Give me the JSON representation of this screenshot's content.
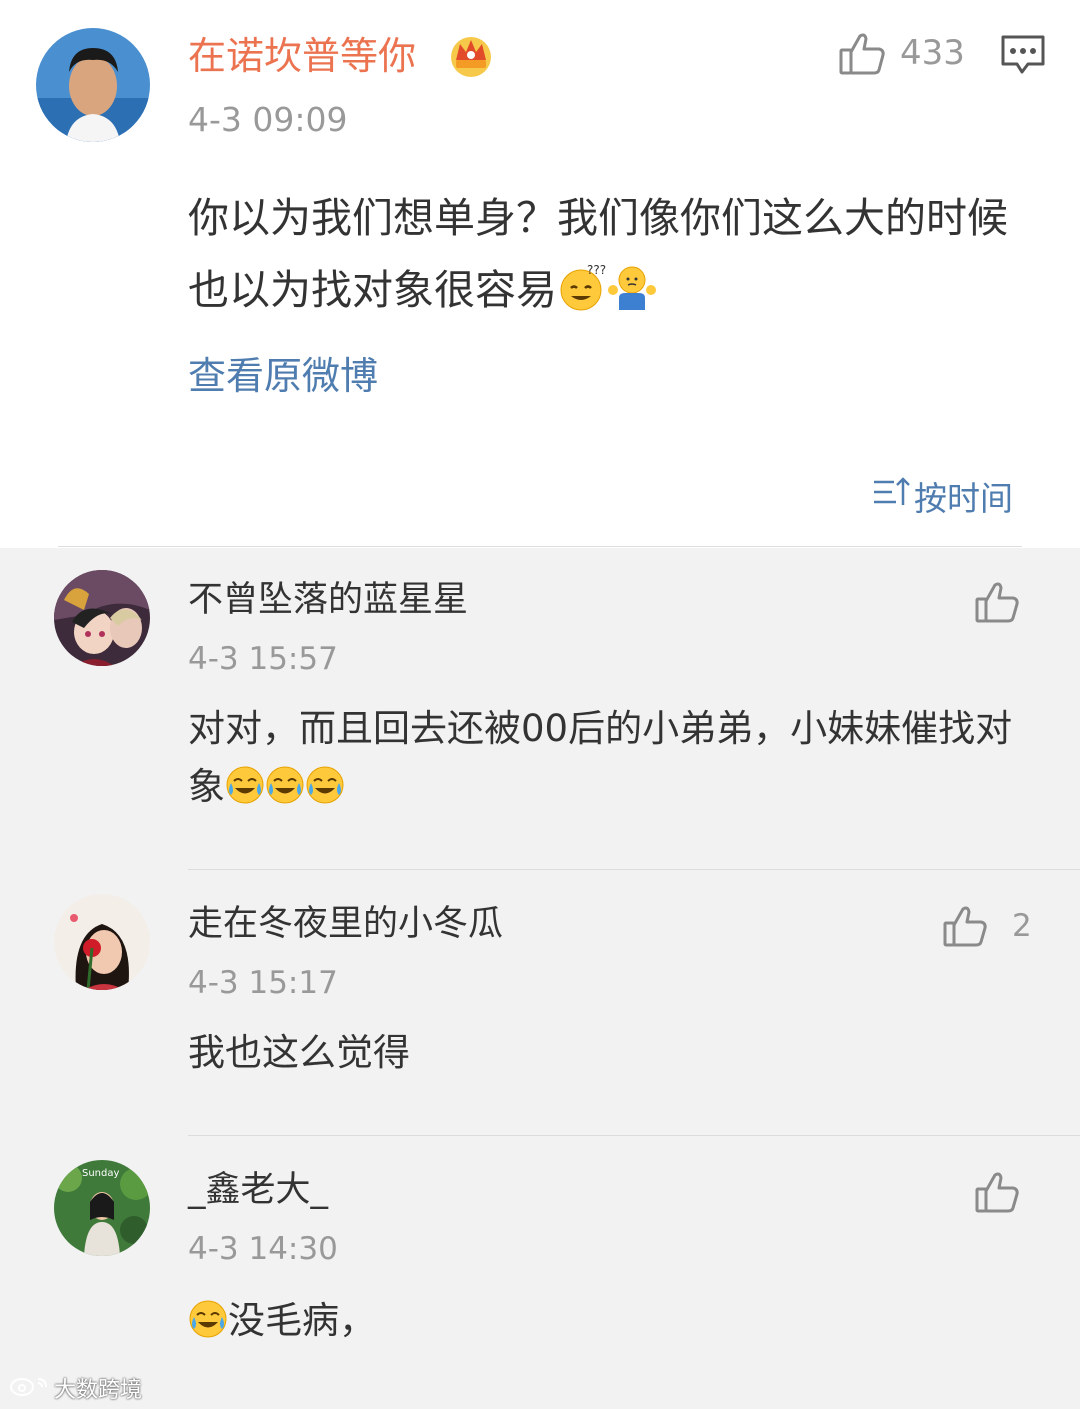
{
  "main_comment": {
    "username": "在诺坎普等你",
    "timestamp": "4-3 09:09",
    "like_count": "433",
    "text": "你以为我们想单身？我们像你们这么大的时候也以为找对象很容易",
    "emojis": [
      "confused-face-emoji",
      "shrug-emoji"
    ],
    "view_original_label": "查看原微博",
    "badge_icon": "crown-vip-icon",
    "like_icon": "thumbs-up-icon",
    "comment_icon": "comment-icon"
  },
  "sort": {
    "label": "按时间",
    "icon": "sort-icon"
  },
  "replies": [
    {
      "username": "不曾坠落的蓝星星",
      "timestamp": "4-3 15:57",
      "like_count": "",
      "text": "对对，而且回去还被00后的小弟弟，小妹妹催找对象",
      "emojis": [
        "crying-laugh-emoji",
        "crying-laugh-emoji",
        "crying-laugh-emoji"
      ]
    },
    {
      "username": "走在冬夜里的小冬瓜",
      "timestamp": "4-3 15:17",
      "like_count": "2",
      "text": "我也这么觉得",
      "emojis": []
    },
    {
      "username": "_鑫老大_",
      "timestamp": "4-3 14:30",
      "like_count": "",
      "text": "没毛病，",
      "emojis": [
        "crying-laugh-emoji"
      ]
    }
  ],
  "watermark": {
    "text": "大数跨境",
    "icon": "weibo-logo-icon"
  },
  "colors": {
    "username_orange": "#eb7350",
    "link_blue": "#507daf",
    "text_dark": "#333333",
    "meta_gray": "#999999",
    "reply_background": "#f2f2f2"
  }
}
